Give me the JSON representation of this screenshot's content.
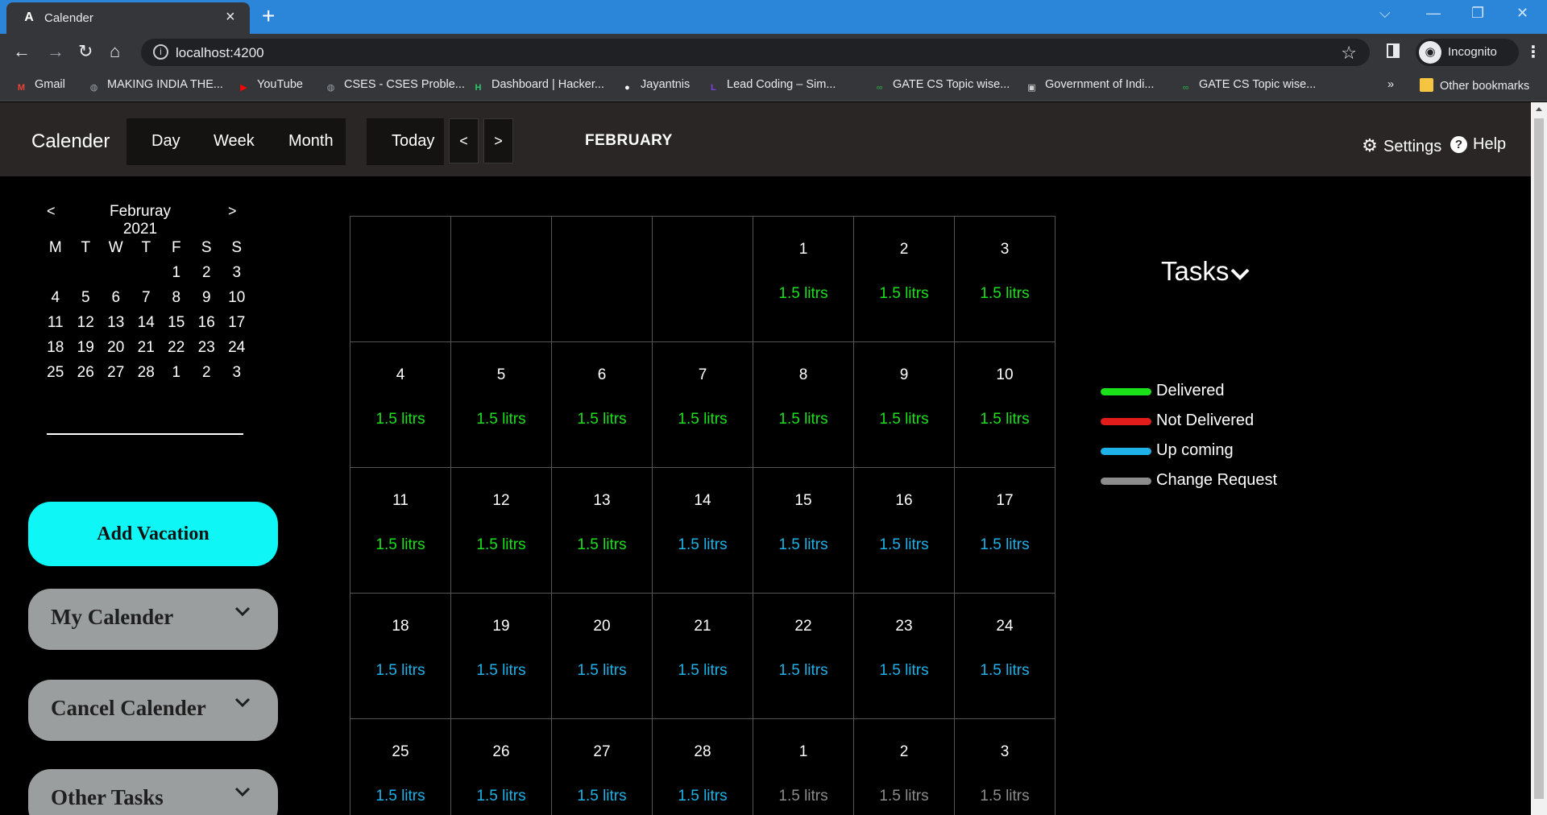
{
  "browser": {
    "tab_title": "Calender",
    "tab_favicon": "A",
    "url": "localhost:4200",
    "profile": "Incognito",
    "bookmarks": [
      {
        "label": "Gmail",
        "icon": "gmail-icon",
        "color": "#ea4335",
        "glyph": "M"
      },
      {
        "label": "MAKING INDIA THE...",
        "icon": "globe-icon",
        "color": "#9aa0a6",
        "glyph": "◍"
      },
      {
        "label": "YouTube",
        "icon": "youtube-icon",
        "color": "#ff0000",
        "glyph": "▶"
      },
      {
        "label": "CSES - CSES Proble...",
        "icon": "globe-icon",
        "color": "#9aa0a6",
        "glyph": "◍"
      },
      {
        "label": "Dashboard | Hacker...",
        "icon": "hackerrank-icon",
        "color": "#2ec866",
        "glyph": "H"
      },
      {
        "label": "Jayantnis",
        "icon": "github-icon",
        "color": "#ffffff",
        "glyph": "●"
      },
      {
        "label": "Lead Coding – Sim...",
        "icon": "leadcoding-icon",
        "color": "#7b3fe4",
        "glyph": "L"
      },
      {
        "label": "GATE CS Topic wise...",
        "icon": "gfg-icon",
        "color": "#2f8d46",
        "glyph": "∞"
      },
      {
        "label": "Government of Indi...",
        "icon": "emblem-icon",
        "color": "#d0d0d0",
        "glyph": "▣"
      },
      {
        "label": "GATE CS Topic wise...",
        "icon": "gfg-icon",
        "color": "#2f8d46",
        "glyph": "∞"
      }
    ],
    "overflow_label": "»",
    "other_bookmarks": "Other bookmarks"
  },
  "app": {
    "title": "Calender",
    "views": [
      "Day",
      "Week",
      "Month"
    ],
    "today": "Today",
    "prev": "<",
    "next": ">",
    "month": "FEBRUARY",
    "settings": "Settings",
    "help": "Help"
  },
  "mini_calendar": {
    "prev": "<",
    "next": ">",
    "title": "Februray 2021",
    "weekdays": [
      "M",
      "T",
      "W",
      "T",
      "F",
      "S",
      "S"
    ],
    "weeks": [
      [
        "",
        "",
        "",
        "",
        "1",
        "2",
        "3"
      ],
      [
        "4",
        "5",
        "6",
        "7",
        "8",
        "9",
        "10"
      ],
      [
        "11",
        "12",
        "13",
        "14",
        "15",
        "16",
        "17"
      ],
      [
        "18",
        "19",
        "20",
        "21",
        "22",
        "23",
        "24"
      ],
      [
        "25",
        "26",
        "27",
        "28",
        "1",
        "2",
        "3"
      ]
    ]
  },
  "sidebar": {
    "add_vacation": "Add Vacation",
    "accordions": [
      "My Calender",
      "Cancel Calender",
      "Other Tasks"
    ]
  },
  "colors": {
    "delivered": "#1be11b",
    "not_delivered": "#e21b1b",
    "upcoming": "#1eb2e8",
    "change_request": "#8c8c8c"
  },
  "month_grid": [
    [
      {
        "d": "",
        "a": "",
        "s": ""
      },
      {
        "d": "",
        "a": "",
        "s": ""
      },
      {
        "d": "",
        "a": "",
        "s": ""
      },
      {
        "d": "",
        "a": "",
        "s": ""
      },
      {
        "d": "1",
        "a": "1.5 litrs",
        "s": "delivered"
      },
      {
        "d": "2",
        "a": "1.5 litrs",
        "s": "delivered"
      },
      {
        "d": "3",
        "a": "1.5 litrs",
        "s": "delivered"
      }
    ],
    [
      {
        "d": "4",
        "a": "1.5 litrs",
        "s": "delivered"
      },
      {
        "d": "5",
        "a": "1.5 litrs",
        "s": "delivered"
      },
      {
        "d": "6",
        "a": "1.5 litrs",
        "s": "delivered"
      },
      {
        "d": "7",
        "a": "1.5 litrs",
        "s": "delivered"
      },
      {
        "d": "8",
        "a": "1.5 litrs",
        "s": "delivered"
      },
      {
        "d": "9",
        "a": "1.5 litrs",
        "s": "delivered"
      },
      {
        "d": "10",
        "a": "1.5 litrs",
        "s": "delivered"
      }
    ],
    [
      {
        "d": "11",
        "a": "1.5 litrs",
        "s": "delivered"
      },
      {
        "d": "12",
        "a": "1.5 litrs",
        "s": "delivered"
      },
      {
        "d": "13",
        "a": "1.5 litrs",
        "s": "delivered"
      },
      {
        "d": "14",
        "a": "1.5 litrs",
        "s": "upcoming"
      },
      {
        "d": "15",
        "a": "1.5 litrs",
        "s": "upcoming"
      },
      {
        "d": "16",
        "a": "1.5 litrs",
        "s": "upcoming"
      },
      {
        "d": "17",
        "a": "1.5 litrs",
        "s": "upcoming"
      }
    ],
    [
      {
        "d": "18",
        "a": "1.5 litrs",
        "s": "upcoming"
      },
      {
        "d": "19",
        "a": "1.5 litrs",
        "s": "upcoming"
      },
      {
        "d": "20",
        "a": "1.5 litrs",
        "s": "upcoming"
      },
      {
        "d": "21",
        "a": "1.5 litrs",
        "s": "upcoming"
      },
      {
        "d": "22",
        "a": "1.5 litrs",
        "s": "upcoming"
      },
      {
        "d": "23",
        "a": "1.5 litrs",
        "s": "upcoming"
      },
      {
        "d": "24",
        "a": "1.5 litrs",
        "s": "upcoming"
      }
    ],
    [
      {
        "d": "25",
        "a": "1.5 litrs",
        "s": "upcoming"
      },
      {
        "d": "26",
        "a": "1.5 litrs",
        "s": "upcoming"
      },
      {
        "d": "27",
        "a": "1.5 litrs",
        "s": "upcoming"
      },
      {
        "d": "28",
        "a": "1.5 litrs",
        "s": "upcoming"
      },
      {
        "d": "1",
        "a": "1.5 litrs",
        "s": "change_request"
      },
      {
        "d": "2",
        "a": "1.5 litrs",
        "s": "change_request"
      },
      {
        "d": "3",
        "a": "1.5 litrs",
        "s": "change_request"
      }
    ]
  ],
  "tasks": {
    "title": "Tasks",
    "legend": [
      {
        "label": "Delivered",
        "key": "delivered"
      },
      {
        "label": "Not Delivered",
        "key": "not_delivered"
      },
      {
        "label": "Up coming",
        "key": "upcoming"
      },
      {
        "label": "Change Request",
        "key": "change_request"
      }
    ]
  }
}
